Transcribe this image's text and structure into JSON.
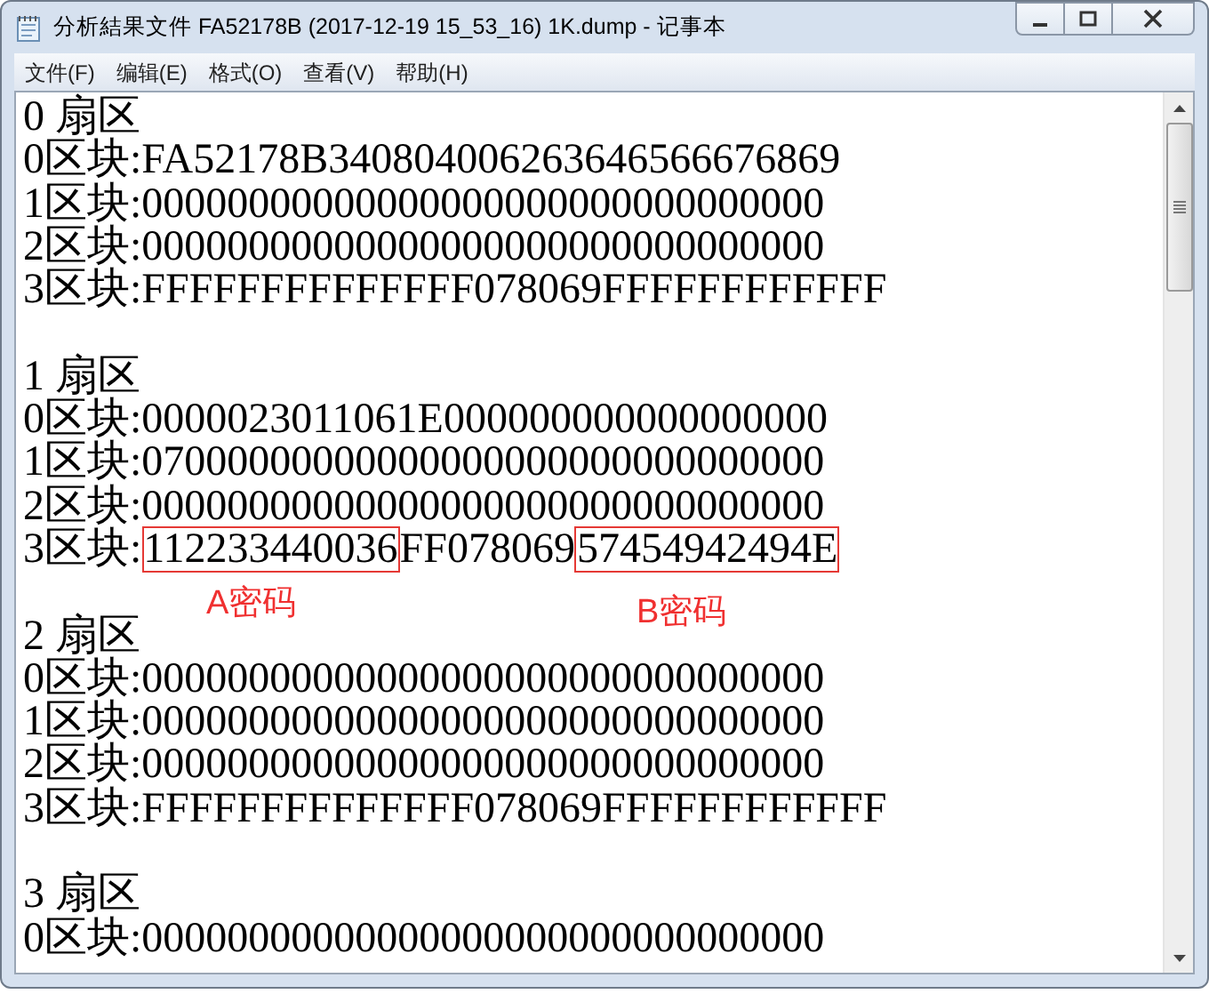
{
  "window": {
    "title": "分析結果文件 FA52178B (2017-12-19 15_53_16) 1K.dump - 记事本"
  },
  "menu": [
    "文件(F)",
    "编辑(E)",
    "格式(O)",
    "查看(V)",
    "帮助(H)"
  ],
  "sectors": [
    {
      "title": "0 扇区",
      "blocks": [
        {
          "label": "0区块:",
          "segments": [
            {
              "text": "FA52178B340804006263646566676869",
              "boxed": false
            }
          ]
        },
        {
          "label": "1区块:",
          "segments": [
            {
              "text": "00000000000000000000000000000000",
              "boxed": false
            }
          ]
        },
        {
          "label": "2区块:",
          "segments": [
            {
              "text": "00000000000000000000000000000000",
              "boxed": false
            }
          ]
        },
        {
          "label": "3区块:",
          "segments": [
            {
              "text": "FFFFFFFFFFFFFF078069FFFFFFFFFFFF",
              "boxed": false
            }
          ]
        }
      ]
    },
    {
      "title": "1 扇区",
      "blocks": [
        {
          "label": "0区块:",
          "segments": [
            {
              "text": "0000023011061E000000000000000000",
              "boxed": false
            }
          ]
        },
        {
          "label": "1区块:",
          "segments": [
            {
              "text": "07000000000000000000000000000000",
              "boxed": false
            }
          ]
        },
        {
          "label": "2区块:",
          "segments": [
            {
              "text": "00000000000000000000000000000000",
              "boxed": false
            }
          ]
        },
        {
          "label": "3区块:",
          "segments": [
            {
              "text": "112233440036",
              "boxed": true
            },
            {
              "text": "FF078069",
              "boxed": false
            },
            {
              "text": "57454942494E",
              "boxed": true
            }
          ]
        }
      ],
      "annotations": [
        "A密码",
        "B密码"
      ]
    },
    {
      "title": "2 扇区",
      "blocks": [
        {
          "label": "0区块:",
          "segments": [
            {
              "text": "00000000000000000000000000000000",
              "boxed": false
            }
          ]
        },
        {
          "label": "1区块:",
          "segments": [
            {
              "text": "00000000000000000000000000000000",
              "boxed": false
            }
          ]
        },
        {
          "label": "2区块:",
          "segments": [
            {
              "text": "00000000000000000000000000000000",
              "boxed": false
            }
          ]
        },
        {
          "label": "3区块:",
          "segments": [
            {
              "text": "FFFFFFFFFFFFFF078069FFFFFFFFFFFF",
              "boxed": false
            }
          ]
        }
      ]
    },
    {
      "title": "3 扇区",
      "blocks": [
        {
          "label": "0区块:",
          "segments": [
            {
              "text": "00000000000000000000000000000000",
              "boxed": false
            }
          ]
        }
      ]
    }
  ]
}
